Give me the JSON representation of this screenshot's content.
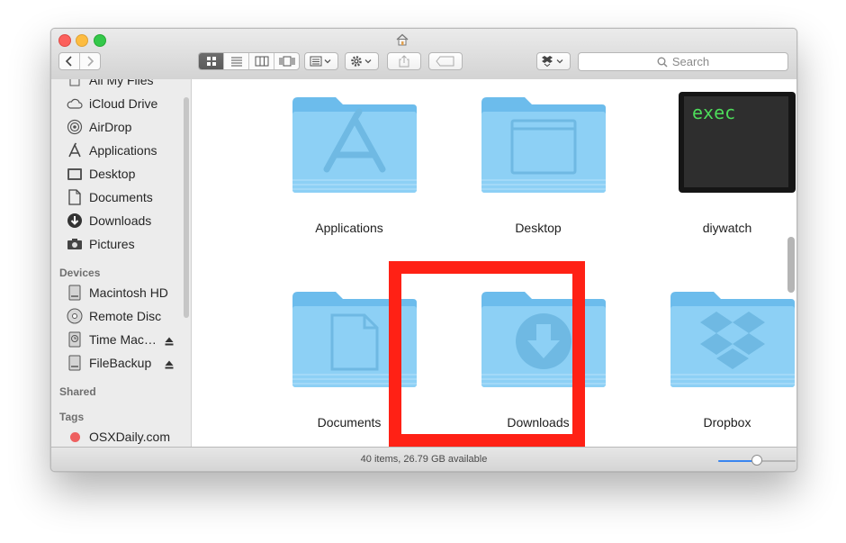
{
  "window": {
    "title_icon": "home-icon"
  },
  "toolbar": {
    "search_placeholder": "Search",
    "view_modes": [
      "icon-view",
      "list-view",
      "column-view",
      "cover-flow-view"
    ],
    "active_view": "icon-view"
  },
  "sidebar": {
    "favorites": [
      {
        "label": "All My Files",
        "icon": "all-files-icon"
      },
      {
        "label": "iCloud Drive",
        "icon": "cloud-icon"
      },
      {
        "label": "AirDrop",
        "icon": "airdrop-icon"
      },
      {
        "label": "Applications",
        "icon": "applications-icon"
      },
      {
        "label": "Desktop",
        "icon": "desktop-icon"
      },
      {
        "label": "Documents",
        "icon": "document-icon"
      },
      {
        "label": "Downloads",
        "icon": "download-icon"
      },
      {
        "label": "Pictures",
        "icon": "camera-icon"
      }
    ],
    "devices_header": "Devices",
    "devices": [
      {
        "label": "Macintosh HD",
        "icon": "hard-drive-icon"
      },
      {
        "label": "Remote Disc",
        "icon": "disc-icon"
      },
      {
        "label": "Time Mac…",
        "icon": "time-machine-icon",
        "eject": true
      },
      {
        "label": "FileBackup",
        "icon": "external-drive-icon",
        "eject": true
      }
    ],
    "shared_header": "Shared",
    "tags_header": "Tags",
    "tags": [
      {
        "label": "OSXDaily.com",
        "color": "#ee6060"
      }
    ]
  },
  "content": {
    "items": [
      {
        "label": "Applications",
        "icon": "applications-folder-icon"
      },
      {
        "label": "Desktop",
        "icon": "desktop-folder-icon"
      },
      {
        "label": "diywatch",
        "icon": "terminal-exec-icon",
        "exec_text": "exec"
      },
      {
        "label": "Documents",
        "icon": "documents-folder-icon"
      },
      {
        "label": "Downloads",
        "icon": "downloads-folder-icon",
        "highlighted": true
      },
      {
        "label": "Dropbox",
        "icon": "dropbox-folder-icon"
      }
    ],
    "highlight_color": "#ff2115"
  },
  "status": {
    "text": "40 items, 26.79 GB available",
    "zoom_level": 0.5
  },
  "colors": {
    "folder": "#8dd0f5",
    "folder_dark": "#6cbcec",
    "accent": "#3a86f0"
  }
}
